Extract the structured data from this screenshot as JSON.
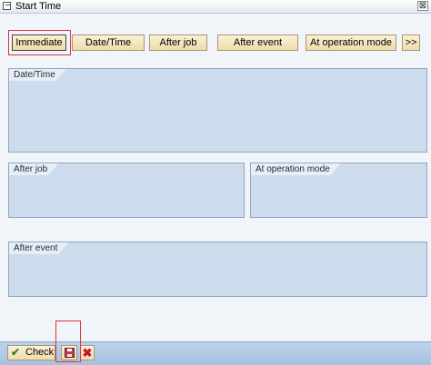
{
  "window": {
    "title": "Start Time",
    "close_glyph": "⊠"
  },
  "toolbar": {
    "immediate": "Immediate",
    "date_time": "Date/Time",
    "after_job": "After job",
    "after_event": "After event",
    "at_operation_mode": "At operation mode",
    "more": ">>"
  },
  "groups": {
    "date_time": "Date/Time",
    "after_job": "After job",
    "at_operation_mode": "At operation mode",
    "after_event": "After event"
  },
  "footer": {
    "check": "Check"
  },
  "colors": {
    "button_bg": "#f3e3b6",
    "group_bg": "#cddcec",
    "footer_bg": "#a6c2e1",
    "highlight": "#d9383f"
  }
}
